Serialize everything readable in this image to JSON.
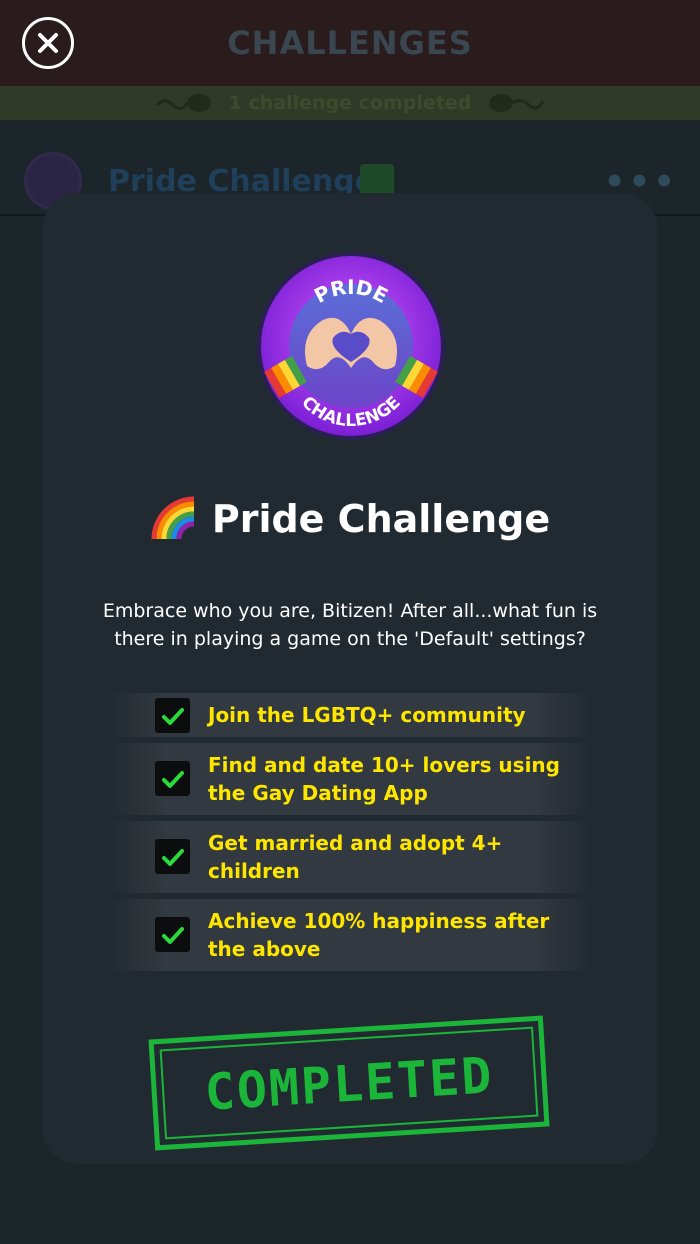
{
  "header": {
    "title": "CHALLENGES",
    "close_icon": "close-icon"
  },
  "progress": {
    "text": "1 challenge completed"
  },
  "background_row": {
    "title": "Pride Challenge",
    "more_icon": "more-dots-icon",
    "more_text": "•••"
  },
  "modal": {
    "badge": {
      "top_text": "PRIDE",
      "bottom_text": "CHALLENGE"
    },
    "title": "Pride Challenge",
    "title_emoji": "rainbow-icon",
    "description": "Embrace who you are, Bitizen! After all...what fun is there in playing a game on the 'Default' settings?",
    "tasks": [
      {
        "label": "Join the LGBTQ+ community",
        "done": true
      },
      {
        "label": "Find and date 10+ lovers using the Gay Dating App",
        "done": true
      },
      {
        "label": "Get married and adopt 4+ children",
        "done": true
      },
      {
        "label": "Achieve 100% happiness after the above",
        "done": true
      }
    ],
    "stamp": "COMPLETED"
  },
  "colors": {
    "task_text": "#ffe600",
    "check": "#2bd93a",
    "stamp_green": "#1bb53a",
    "modal_bg": "#222a31"
  }
}
